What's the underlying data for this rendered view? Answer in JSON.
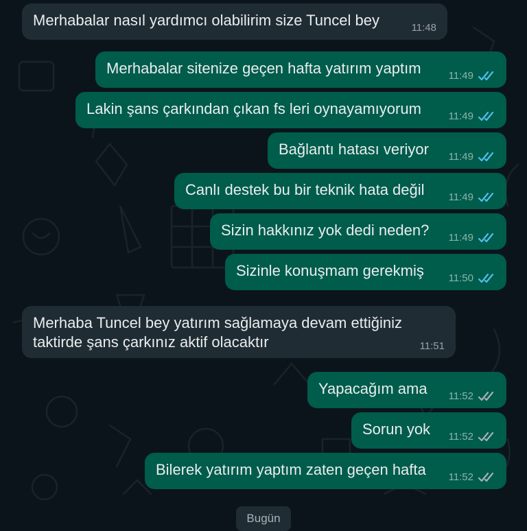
{
  "chat": {
    "messages": [
      {
        "text": "Merhabalar nasıl yardımcı olabilirim size Tuncel bey",
        "time": "11:48"
      },
      {
        "text": "Merhabalar sitenize geçen hafta yatırım yaptım",
        "time": "11:49"
      },
      {
        "text": "Lakin şans çarkından çıkan fs leri oynayamıyorum",
        "time": "11:49"
      },
      {
        "text": "Bağlantı hatası veriyor",
        "time": "11:49"
      },
      {
        "text": "Canlı destek bu bir teknik hata değil",
        "time": "11:49"
      },
      {
        "text": "Sizin hakkınız yok dedi neden?",
        "time": "11:49"
      },
      {
        "text": "Sizinle konuşmam gerekmiş",
        "time": "11:50"
      },
      {
        "text": "Merhaba Tuncel bey yatırım sağlamaya devam ettiğiniz taktirde şans çarkınız aktif olacaktır",
        "time": "11:51"
      },
      {
        "text": "Yapacağım ama",
        "time": "11:52"
      },
      {
        "text": "Sorun yok",
        "time": "11:52"
      },
      {
        "text": "Bilerek yatırım yaptım zaten geçen hafta",
        "time": "11:52"
      }
    ],
    "date_divider": "Bugün"
  },
  "colors": {
    "background": "#0b141a",
    "incoming_bubble": "#202c33",
    "outgoing_bubble": "#005c4b",
    "read_tick": "#53bdeb",
    "delivered_tick": "#a7b1b6"
  },
  "icons": {
    "read": "double-check-blue-icon",
    "delivered": "double-check-grey-icon"
  }
}
